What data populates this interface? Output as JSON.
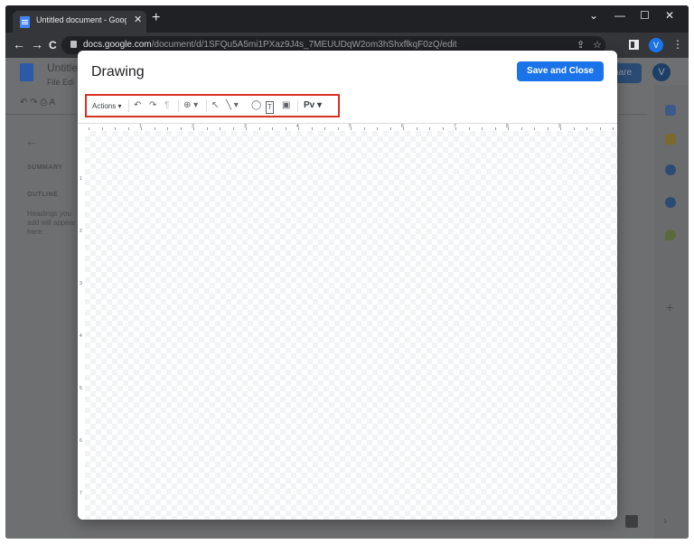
{
  "browser": {
    "tab_title": "Untitled document - Google Doc",
    "tab_close": "✕",
    "new_tab": "+",
    "url_domain": "docs.google.com",
    "url_path": "/document/d/1SFQu5A5mi1PXaz9J4s_7MEUUDqW2om3hShxflkqF0zQ/edit",
    "profile_letter": "V",
    "window_controls": [
      "⌄",
      "—",
      "☐",
      "✕"
    ],
    "nav": {
      "back": "←",
      "forward": "→",
      "reload": "C"
    }
  },
  "docs": {
    "title": "Untitled",
    "menu": "File  Edi",
    "share_label": "hare",
    "avatar_letter": "V",
    "outline": {
      "summary": "SUMMARY",
      "outline": "OUTLINE",
      "hint": "Headings you add will appear here."
    }
  },
  "dialog": {
    "title": "Drawing",
    "save_label": "Save and Close",
    "toolbar": {
      "actions_label": "Actions ▾",
      "undo": "↶",
      "redo": "↷",
      "paint_format": "¶",
      "zoom": "⊕ ▾",
      "select": "↖",
      "line": "╲ ▾",
      "shape": "◯",
      "text_box": "T",
      "image": "▣",
      "word_art": "Pv ▾"
    },
    "ruler_h": [
      "1",
      "2",
      "3",
      "4",
      "5",
      "6",
      "7",
      "8",
      "9"
    ],
    "ruler_v": [
      "1",
      "2",
      "3",
      "4",
      "5",
      "6",
      "7"
    ]
  },
  "colors": {
    "accent": "#1a73e8",
    "highlight_border": "#d93025"
  }
}
